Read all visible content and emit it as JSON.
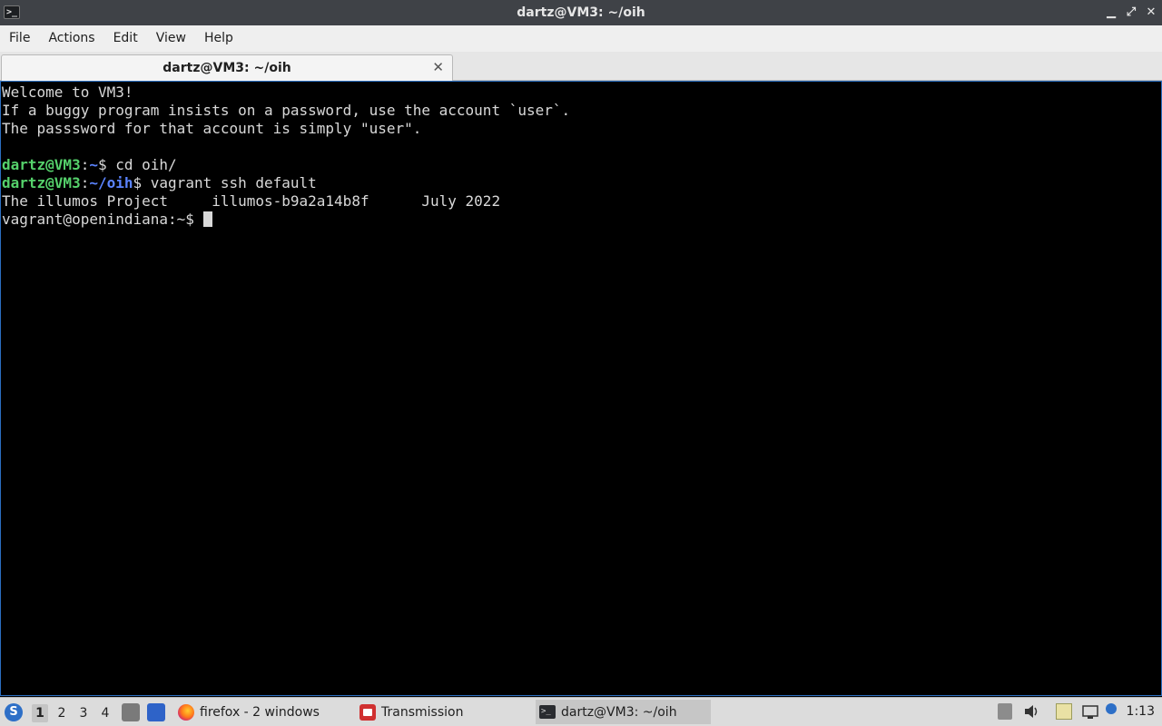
{
  "window": {
    "title": "dartz@VM3: ~/oih",
    "app_icon_glyph": ">_",
    "buttons": {
      "minimize": "▁",
      "maximize": "⤢",
      "close": "✕"
    }
  },
  "menu": {
    "items": [
      "File",
      "Actions",
      "Edit",
      "View",
      "Help"
    ]
  },
  "tab": {
    "label": "dartz@VM3: ~/oih",
    "close_glyph": "✕"
  },
  "terminal": {
    "welcome": "Welcome to VM3!",
    "line2": "If a buggy program insists on a password, use the account `user`.",
    "line3": "The passsword for that account is simply \"user\".",
    "prompt1_user": "dartz@VM3",
    "prompt1_sep": ":",
    "prompt1_path": "~",
    "prompt1_cmd": "$ cd oih/",
    "prompt2_user": "dartz@VM3",
    "prompt2_sep": ":",
    "prompt2_path": "~/oih",
    "prompt2_cmd": "$ vagrant ssh default",
    "motd": "The illumos Project     illumos-b9a2a14b8f      July 2022",
    "remote_prompt": "vagrant@openindiana:~$ "
  },
  "taskbar": {
    "workspaces": [
      "1",
      "2",
      "3",
      "4"
    ],
    "active_workspace": "1",
    "tasks": {
      "firefox": "firefox - 2 windows",
      "transmission": "Transmission",
      "terminal": "dartz@VM3: ~/oih"
    },
    "clock": "1:13"
  },
  "colors": {
    "prompt_user": "#55d16b",
    "prompt_path": "#5b84ff",
    "terminal_bg": "#000000",
    "terminal_fg": "#d9d9d9",
    "titlebar_bg": "#3f4247",
    "taskbar_bg": "#dcdcdc"
  }
}
